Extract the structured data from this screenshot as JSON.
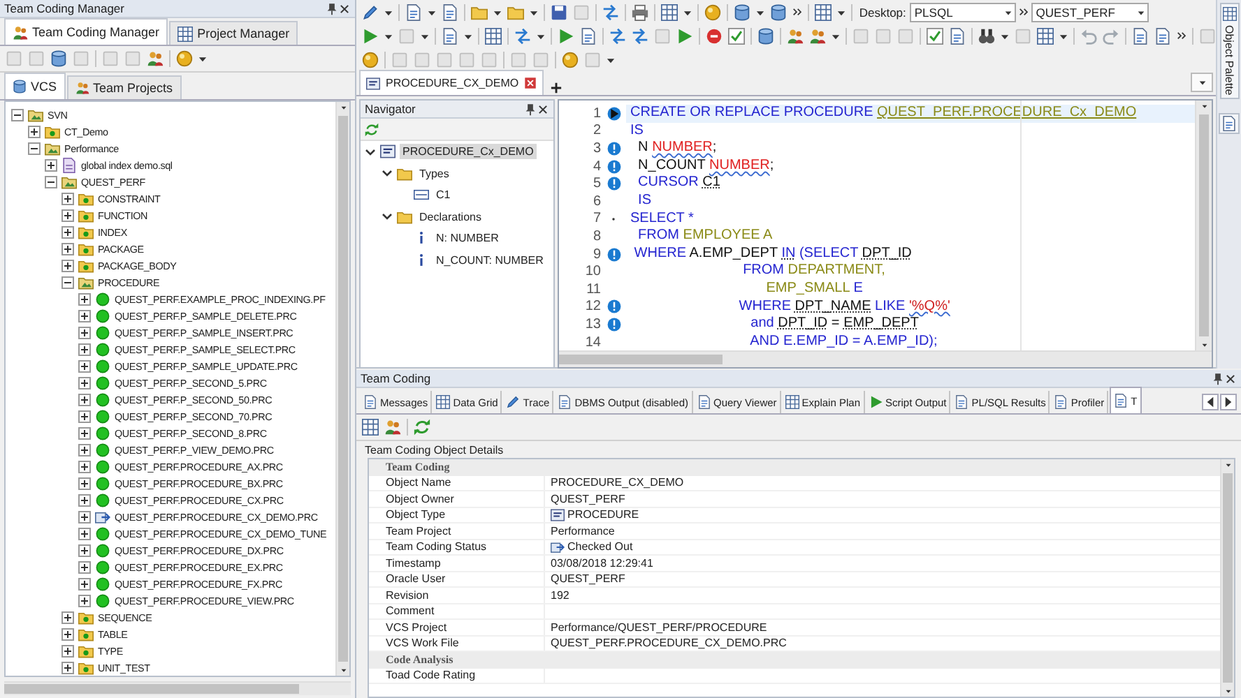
{
  "left_panel": {
    "title": "Team Coding Manager",
    "tabs": [
      {
        "label": "Team Coding Manager",
        "selected": true
      },
      {
        "label": "Project Manager",
        "selected": false
      }
    ],
    "subtabs": [
      {
        "label": "VCS",
        "selected": true
      },
      {
        "label": "Team Projects",
        "selected": false
      }
    ],
    "tree": [
      {
        "label": "SVN",
        "kind": "open_folder",
        "expanded": true,
        "children": [
          {
            "label": "CT_Demo",
            "kind": "folder",
            "expanded": false
          },
          {
            "label": "Performance",
            "kind": "open_folder",
            "expanded": true,
            "children": [
              {
                "label": "global index demo.sql",
                "kind": "file",
                "expanded": false
              },
              {
                "label": "QUEST_PERF",
                "kind": "open_folder",
                "expanded": true,
                "children": [
                  {
                    "label": "CONSTRAINT",
                    "kind": "folder",
                    "expanded": false
                  },
                  {
                    "label": "FUNCTION",
                    "kind": "folder",
                    "expanded": false
                  },
                  {
                    "label": "INDEX",
                    "kind": "folder",
                    "expanded": false
                  },
                  {
                    "label": "PACKAGE",
                    "kind": "folder",
                    "expanded": false
                  },
                  {
                    "label": "PACKAGE_BODY",
                    "kind": "folder",
                    "expanded": false
                  },
                  {
                    "label": "PROCEDURE",
                    "kind": "open_folder",
                    "expanded": true,
                    "children": [
                      {
                        "label": "QUEST_PERF.EXAMPLE_PROC_INDEXING.PF",
                        "kind": "ok",
                        "expanded": false
                      },
                      {
                        "label": "QUEST_PERF.P_SAMPLE_DELETE.PRC",
                        "kind": "ok",
                        "expanded": false
                      },
                      {
                        "label": "QUEST_PERF.P_SAMPLE_INSERT.PRC",
                        "kind": "ok",
                        "expanded": false
                      },
                      {
                        "label": "QUEST_PERF.P_SAMPLE_SELECT.PRC",
                        "kind": "ok",
                        "expanded": false
                      },
                      {
                        "label": "QUEST_PERF.P_SAMPLE_UPDATE.PRC",
                        "kind": "ok",
                        "expanded": false
                      },
                      {
                        "label": "QUEST_PERF.P_SECOND_5.PRC",
                        "kind": "ok",
                        "expanded": false
                      },
                      {
                        "label": "QUEST_PERF.P_SECOND_50.PRC",
                        "kind": "ok",
                        "expanded": false
                      },
                      {
                        "label": "QUEST_PERF.P_SECOND_70.PRC",
                        "kind": "ok",
                        "expanded": false
                      },
                      {
                        "label": "QUEST_PERF.P_SECOND_8.PRC",
                        "kind": "ok",
                        "expanded": false
                      },
                      {
                        "label": "QUEST_PERF.P_VIEW_DEMO.PRC",
                        "kind": "ok",
                        "expanded": false
                      },
                      {
                        "label": "QUEST_PERF.PROCEDURE_AX.PRC",
                        "kind": "ok",
                        "expanded": false
                      },
                      {
                        "label": "QUEST_PERF.PROCEDURE_BX.PRC",
                        "kind": "ok",
                        "expanded": false
                      },
                      {
                        "label": "QUEST_PERF.PROCEDURE_CX.PRC",
                        "kind": "ok",
                        "expanded": false
                      },
                      {
                        "label": "QUEST_PERF.PROCEDURE_CX_DEMO.PRC",
                        "kind": "checked_out",
                        "expanded": false
                      },
                      {
                        "label": "QUEST_PERF.PROCEDURE_CX_DEMO_TUNE",
                        "kind": "ok",
                        "expanded": false
                      },
                      {
                        "label": "QUEST_PERF.PROCEDURE_DX.PRC",
                        "kind": "ok",
                        "expanded": false
                      },
                      {
                        "label": "QUEST_PERF.PROCEDURE_EX.PRC",
                        "kind": "ok",
                        "expanded": false
                      },
                      {
                        "label": "QUEST_PERF.PROCEDURE_FX.PRC",
                        "kind": "ok",
                        "expanded": false
                      },
                      {
                        "label": "QUEST_PERF.PROCEDURE_VIEW.PRC",
                        "kind": "ok",
                        "expanded": false
                      }
                    ]
                  },
                  {
                    "label": "SEQUENCE",
                    "kind": "folder",
                    "expanded": false
                  },
                  {
                    "label": "TABLE",
                    "kind": "folder",
                    "expanded": false
                  },
                  {
                    "label": "TYPE",
                    "kind": "folder",
                    "expanded": false
                  },
                  {
                    "label": "UNIT_TEST",
                    "kind": "folder",
                    "expanded": false
                  }
                ]
              }
            ]
          }
        ]
      }
    ]
  },
  "toolbar": {
    "desktop_label": "Desktop:",
    "desktop": "PLSQL",
    "connection": "QUEST_PERF"
  },
  "object_palette": {
    "label": "Object Palette"
  },
  "editor_tabs": [
    {
      "label": "PROCEDURE_CX_DEMO",
      "selected": true
    }
  ],
  "navigator": {
    "title": "Navigator",
    "tree": [
      {
        "label": "PROCEDURE_Cx_DEMO",
        "kind": "procedure",
        "selected": true,
        "expanded": true,
        "children": [
          {
            "label": "Types",
            "kind": "folder",
            "selected": false,
            "expanded": true,
            "children": [
              {
                "label": "C1",
                "kind": "cursor",
                "selected": false
              }
            ]
          },
          {
            "label": "Declarations",
            "kind": "folder",
            "selected": false,
            "expanded": true,
            "children": [
              {
                "label": "N: NUMBER",
                "kind": "variable",
                "selected": false
              },
              {
                "label": "N_COUNT: NUMBER",
                "kind": "variable",
                "selected": false
              }
            ]
          }
        ]
      }
    ]
  },
  "editor": {
    "lines": [
      {
        "num": "1",
        "kind": "run",
        "current": true,
        "tokens": [
          {
            "text": "CREATE OR REPLACE PROCEDURE ",
            "kind": "kw"
          },
          {
            "text": "QUEST_PERF.PROCEDURE_Cx_DEMO",
            "kind": "obu"
          }
        ]
      },
      {
        "num": "2",
        "kind": "plain",
        "current": false,
        "tokens": [
          {
            "text": "IS",
            "kind": "kw"
          }
        ]
      },
      {
        "num": "3",
        "kind": "info",
        "current": false,
        "tokens": [
          {
            "text": "  N ",
            "kind": "pl"
          },
          {
            "text": "NUMBER",
            "kind": "er"
          },
          {
            "text": ";",
            "kind": "pl"
          }
        ]
      },
      {
        "num": "4",
        "kind": "info",
        "current": false,
        "tokens": [
          {
            "text": "  N_COUNT ",
            "kind": "pl"
          },
          {
            "text": "NUMBER",
            "kind": "er"
          },
          {
            "text": ";",
            "kind": "pl"
          }
        ]
      },
      {
        "num": "5",
        "kind": "info",
        "current": false,
        "tokens": [
          {
            "text": "  CURSOR ",
            "kind": "kw"
          },
          {
            "text": "C1",
            "kind": "lk"
          }
        ]
      },
      {
        "num": "6",
        "kind": "plain",
        "current": false,
        "tokens": [
          {
            "text": "  IS",
            "kind": "kw"
          }
        ]
      },
      {
        "num": "7",
        "kind": "dot",
        "current": false,
        "tokens": [
          {
            "text": "SELECT *",
            "kind": "kw"
          }
        ]
      },
      {
        "num": "8",
        "kind": "plain",
        "current": false,
        "tokens": [
          {
            "text": "  FROM ",
            "kind": "kw"
          },
          {
            "text": "EMPLOYEE A",
            "kind": "ob"
          }
        ]
      },
      {
        "num": "9",
        "kind": "info",
        "current": false,
        "tokens": [
          {
            "text": " WHERE ",
            "kind": "kw"
          },
          {
            "text": "A.EMP_DEPT ",
            "kind": "pl"
          },
          {
            "text": "IN",
            "kind": "kwu"
          },
          {
            "text": " (SELECT ",
            "kind": "kw"
          },
          {
            "text": "DPT_ID",
            "kind": "lk"
          }
        ]
      },
      {
        "num": "10",
        "kind": "plain",
        "current": false,
        "tokens": [
          {
            "text": "                             FROM ",
            "kind": "kw"
          },
          {
            "text": "DEPARTMENT,",
            "kind": "ob"
          }
        ]
      },
      {
        "num": "11",
        "kind": "plain",
        "current": false,
        "tokens": [
          {
            "text": "                                   EMP_SMALL ",
            "kind": "ob"
          },
          {
            "text": "E",
            "kind": "kw"
          }
        ]
      },
      {
        "num": "12",
        "kind": "info",
        "current": false,
        "tokens": [
          {
            "text": "                            WHERE ",
            "kind": "kw"
          },
          {
            "text": "DPT_NAME",
            "kind": "lk"
          },
          {
            "text": " LIKE ",
            "kind": "kw"
          },
          {
            "text": "'%Q%'",
            "kind": "st"
          }
        ]
      },
      {
        "num": "13",
        "kind": "info",
        "current": false,
        "tokens": [
          {
            "text": "                               and ",
            "kind": "kw"
          },
          {
            "text": "DPT_ID",
            "kind": "lk"
          },
          {
            "text": " = ",
            "kind": "pl"
          },
          {
            "text": "EMP_DEPT",
            "kind": "lk"
          }
        ]
      },
      {
        "num": "14",
        "kind": "plain",
        "current": false,
        "tokens": [
          {
            "text": "                               AND E.EMP_ID = A.EMP_ID);",
            "kind": "kw"
          }
        ]
      }
    ]
  },
  "team_coding": {
    "title": "Team Coding",
    "tabs": [
      {
        "label": "Messages",
        "selected": false
      },
      {
        "label": "Data Grid",
        "selected": false
      },
      {
        "label": "Trace",
        "selected": false
      },
      {
        "label": "DBMS Output (disabled)",
        "selected": false
      },
      {
        "label": "Query Viewer",
        "selected": false
      },
      {
        "label": "Explain Plan",
        "selected": false
      },
      {
        "label": "Script Output",
        "selected": false
      },
      {
        "label": "PL/SQL Results",
        "selected": false
      },
      {
        "label": "Profiler",
        "selected": false
      },
      {
        "label": "T",
        "selected": true
      }
    ],
    "details_title": "Team Coding Object Details",
    "sections": [
      {
        "title": "Team Coding",
        "rows": [
          {
            "name": "Object Name",
            "kind": "text",
            "value": "PROCEDURE_CX_DEMO"
          },
          {
            "name": "Object Owner",
            "kind": "text",
            "value": "QUEST_PERF"
          },
          {
            "name": "Object Type",
            "kind": "procedure",
            "value": "PROCEDURE"
          },
          {
            "name": "Team Project",
            "kind": "text",
            "value": "Performance"
          },
          {
            "name": "Team Coding Status",
            "kind": "status",
            "value": "Checked Out"
          },
          {
            "name": "Timestamp",
            "kind": "text",
            "value": "03/08/2018 12:29:41"
          },
          {
            "name": "Oracle User",
            "kind": "text",
            "value": "QUEST_PERF"
          },
          {
            "name": "Revision",
            "kind": "text",
            "value": "192"
          },
          {
            "name": "Comment",
            "kind": "text"
          },
          {
            "name": "VCS Project",
            "kind": "text",
            "value": "Performance/QUEST_PERF/PROCEDURE"
          },
          {
            "name": "VCS Work File",
            "kind": "text",
            "value": "QUEST_PERF.PROCEDURE_CX_DEMO.PRC"
          }
        ]
      },
      {
        "title": "Code Analysis",
        "rows": [
          {
            "name": "Toad Code Rating",
            "kind": "text"
          }
        ]
      }
    ]
  }
}
